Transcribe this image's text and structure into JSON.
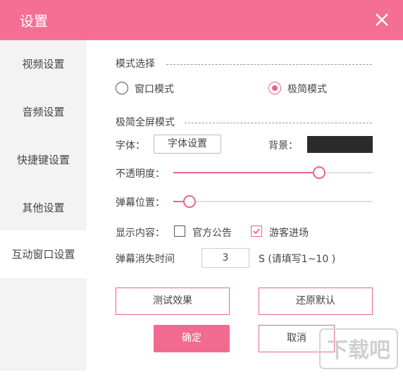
{
  "window": {
    "title": "设置"
  },
  "sidebar": {
    "items": [
      {
        "label": "视频设置"
      },
      {
        "label": "音频设置"
      },
      {
        "label": "快捷键设置"
      },
      {
        "label": "其他设置"
      },
      {
        "label": "互动窗口设置",
        "active": true
      }
    ]
  },
  "mode": {
    "section_title": "模式选择",
    "options": [
      {
        "label": "窗口模式",
        "checked": false
      },
      {
        "label": "极简模式",
        "checked": true
      }
    ]
  },
  "fullscreen": {
    "section_title": "极简全屏模式",
    "font_label": "字体：",
    "font_button": "字体设置",
    "bg_label": "背景：",
    "bg_color": "#2b2b2b",
    "opacity_label": "不透明度：",
    "opacity_value": 0.73,
    "position_label": "弹幕位置：",
    "position_value": 0.08,
    "display_label": "显示内容：",
    "display_options": [
      {
        "label": "官方公告",
        "checked": false
      },
      {
        "label": "游客进场",
        "checked": true
      }
    ],
    "vanish_label": "弹幕消失时间",
    "vanish_value": "3",
    "vanish_hint": "S (请填写1~10 )"
  },
  "actions": {
    "test_label": "测试效果",
    "reset_label": "还原默认",
    "ok_label": "确定",
    "cancel_label": "取消"
  },
  "colors": {
    "accent": "#f56e93",
    "accent_dark": "#e8678b"
  },
  "watermark": {
    "text": "下载吧"
  }
}
